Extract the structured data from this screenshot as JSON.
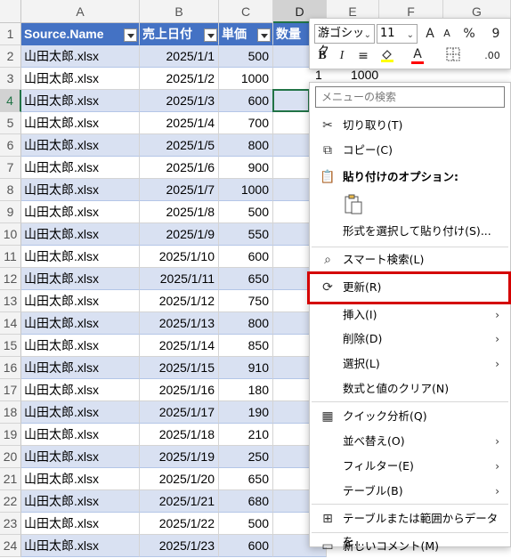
{
  "columns": [
    "A",
    "B",
    "C",
    "D",
    "E",
    "F",
    "G"
  ],
  "headers": [
    "Source.Name",
    "売上日付",
    "単価",
    "数量"
  ],
  "rows": [
    {
      "n": "2",
      "a": "山田太郎.xlsx",
      "b": "2025/1/1",
      "c": "500"
    },
    {
      "n": "3",
      "a": "山田太郎.xlsx",
      "b": "2025/1/2",
      "c": "1000"
    },
    {
      "n": "4",
      "a": "山田太郎.xlsx",
      "b": "2025/1/3",
      "c": "600"
    },
    {
      "n": "5",
      "a": "山田太郎.xlsx",
      "b": "2025/1/4",
      "c": "700"
    },
    {
      "n": "6",
      "a": "山田太郎.xlsx",
      "b": "2025/1/5",
      "c": "800"
    },
    {
      "n": "7",
      "a": "山田太郎.xlsx",
      "b": "2025/1/6",
      "c": "900"
    },
    {
      "n": "8",
      "a": "山田太郎.xlsx",
      "b": "2025/1/7",
      "c": "1000"
    },
    {
      "n": "9",
      "a": "山田太郎.xlsx",
      "b": "2025/1/8",
      "c": "500"
    },
    {
      "n": "10",
      "a": "山田太郎.xlsx",
      "b": "2025/1/9",
      "c": "550"
    },
    {
      "n": "11",
      "a": "山田太郎.xlsx",
      "b": "2025/1/10",
      "c": "600"
    },
    {
      "n": "12",
      "a": "山田太郎.xlsx",
      "b": "2025/1/11",
      "c": "650"
    },
    {
      "n": "13",
      "a": "山田太郎.xlsx",
      "b": "2025/1/12",
      "c": "750"
    },
    {
      "n": "14",
      "a": "山田太郎.xlsx",
      "b": "2025/1/13",
      "c": "800"
    },
    {
      "n": "15",
      "a": "山田太郎.xlsx",
      "b": "2025/1/14",
      "c": "850"
    },
    {
      "n": "16",
      "a": "山田太郎.xlsx",
      "b": "2025/1/15",
      "c": "910"
    },
    {
      "n": "17",
      "a": "山田太郎.xlsx",
      "b": "2025/1/16",
      "c": "180"
    },
    {
      "n": "18",
      "a": "山田太郎.xlsx",
      "b": "2025/1/17",
      "c": "190"
    },
    {
      "n": "19",
      "a": "山田太郎.xlsx",
      "b": "2025/1/18",
      "c": "210"
    },
    {
      "n": "20",
      "a": "山田太郎.xlsx",
      "b": "2025/1/19",
      "c": "250"
    },
    {
      "n": "21",
      "a": "山田太郎.xlsx",
      "b": "2025/1/20",
      "c": "650"
    },
    {
      "n": "22",
      "a": "山田太郎.xlsx",
      "b": "2025/1/21",
      "c": "680"
    },
    {
      "n": "23",
      "a": "山田太郎.xlsx",
      "b": "2025/1/22",
      "c": "500"
    },
    {
      "n": "24",
      "a": "山田太郎.xlsx",
      "b": "2025/1/23",
      "c": "600"
    }
  ],
  "row1_label": "1",
  "d2_e2": {
    "d": "1",
    "e": "1000"
  },
  "mini_toolbar": {
    "font_name": "游ゴシック",
    "font_size": "11",
    "grow": "A",
    "shrink": "A",
    "currency": "%",
    "comma": "9",
    "bold": "B",
    "italic": "I",
    "font_color": "A",
    "decrease_decimal": ".00"
  },
  "context_menu": {
    "search_placeholder": "メニューの検索",
    "cut": "切り取り(T)",
    "copy": "コピー(C)",
    "paste_options": "貼り付けのオプション:",
    "paste_special": "形式を選択して貼り付け(S)...",
    "smart_lookup": "スマート検索(L)",
    "refresh": "更新(R)",
    "insert": "挿入(I)",
    "delete": "削除(D)",
    "select": "選択(L)",
    "clear": "数式と値のクリア(N)",
    "quick_analysis": "クイック分析(Q)",
    "sort": "並べ替え(O)",
    "filter": "フィルター(E)",
    "table": "テーブル(B)",
    "from_table": "テーブルまたは範囲からデータを...",
    "new_comment": "新しいコメント(M)"
  },
  "colors": {
    "header": "#4472c4",
    "band": "#d9e1f2",
    "highlight": "#d40000",
    "select": "#217346"
  }
}
